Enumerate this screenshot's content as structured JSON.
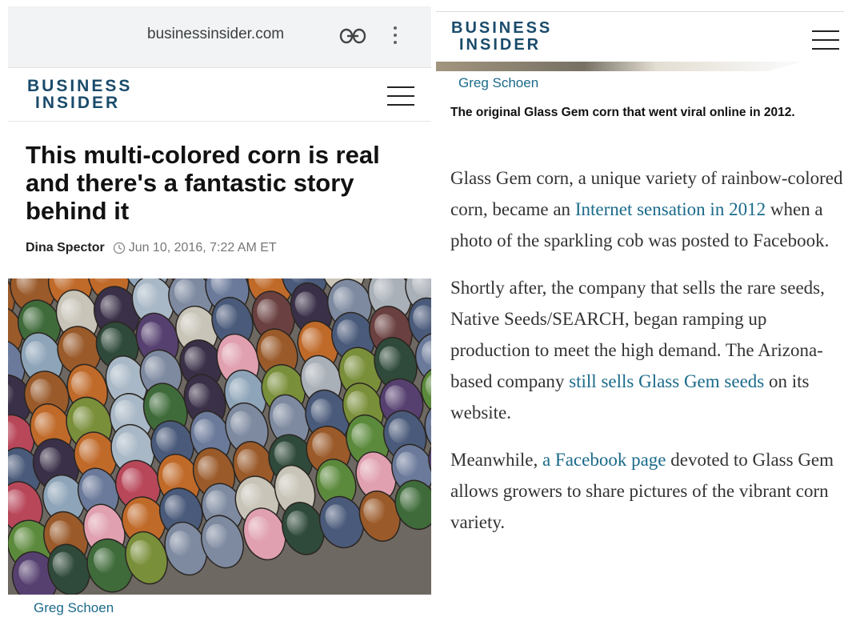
{
  "browser": {
    "url": "businessinsider.com"
  },
  "brand": {
    "logo_line1": "BUSINESS",
    "logo_line2": "INSIDER",
    "color": "#1a4b6b"
  },
  "article": {
    "headline": "This multi-colored corn is real and there's a fantastic story behind it",
    "author": "Dina Spector",
    "date": "Jun 10, 2016, 7:22 AM ET",
    "photo_credit": "Greg Schoen",
    "caption": "The original Glass Gem corn that went viral online in 2012.",
    "paragraphs": [
      {
        "before": "Glass Gem corn, a unique variety of rainbow-colored corn, became an ",
        "link": "Internet sensation in 2012",
        "after": " when a photo of the sparkling cob was posted to Facebook."
      },
      {
        "before": "Shortly after, the company that sells the rare seeds, Native Seeds/SEARCH, began ramping up production to meet the high demand. The Arizona-based company ",
        "link": "still sells Glass Gem seeds",
        "after": " on its website."
      },
      {
        "before": "Meanwhile, ",
        "link": "a Facebook page",
        "after": " devoted to Glass Gem allows growers to share pictures of the vibrant corn variety."
      }
    ]
  },
  "icons": {
    "link": "link-icon",
    "menu": "more-vert-icon",
    "hamburger": "hamburger-menu-icon",
    "clock": "clock-icon"
  },
  "colors": {
    "link": "#1a6a8a",
    "headline": "#111111"
  }
}
